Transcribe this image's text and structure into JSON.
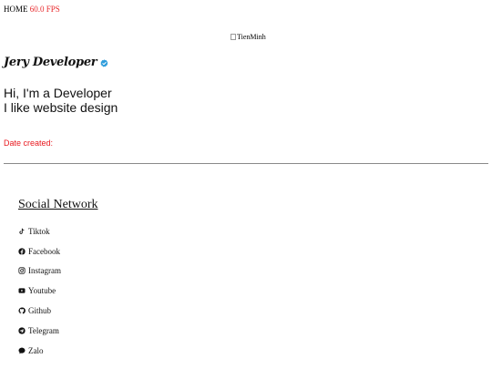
{
  "topbar": {
    "home_label": "HOME",
    "fps_label": "60.0 FPS",
    "fps_color": "#e8282b"
  },
  "banner": {
    "alt_text": "TienMinh"
  },
  "profile": {
    "name": "Jery Developer",
    "verified_icon": "verified-badge-icon",
    "verified_color": "#2d9cdb",
    "intro_line1": "Hi, I'm a Developer",
    "intro_line2": "I like website design",
    "date_created_label": "Date created:",
    "date_created_color": "#e8191f"
  },
  "social": {
    "title": "Social Network",
    "items": [
      {
        "label": "Tiktok",
        "icon": "tiktok-icon"
      },
      {
        "label": "Facebook",
        "icon": "facebook-icon"
      },
      {
        "label": "Instagram",
        "icon": "instagram-icon"
      },
      {
        "label": "Youtube",
        "icon": "youtube-icon"
      },
      {
        "label": "Github",
        "icon": "github-icon"
      },
      {
        "label": "Telegram",
        "icon": "telegram-icon"
      },
      {
        "label": "Zalo",
        "icon": "zalo-icon"
      }
    ]
  }
}
